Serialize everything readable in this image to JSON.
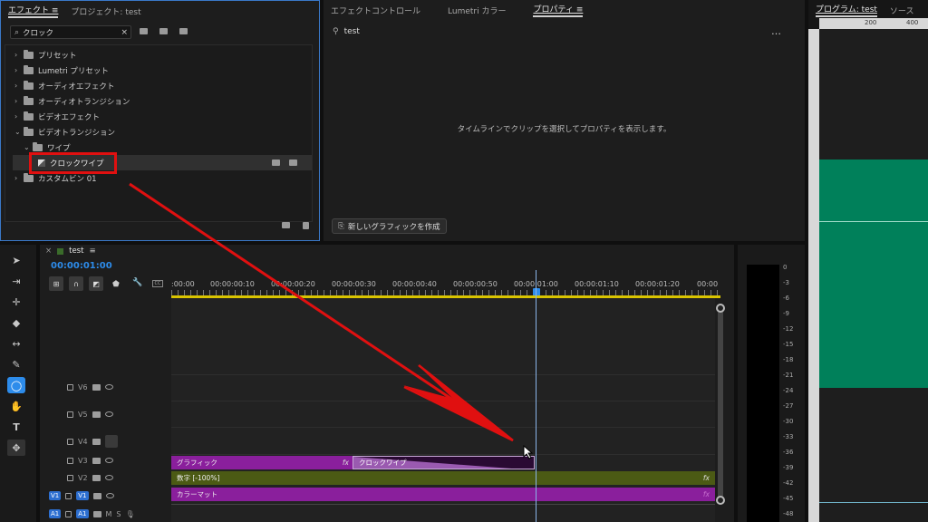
{
  "effects_panel": {
    "tabs": [
      "エフェクト",
      "プロジェクト: test"
    ],
    "menu_icon": "hamburger-icon",
    "search_value": "クロック",
    "tree": [
      {
        "label": "プリセット",
        "expanded": false
      },
      {
        "label": "Lumetri プリセット",
        "expanded": false
      },
      {
        "label": "オーディオエフェクト",
        "expanded": false
      },
      {
        "label": "オーディオトランジション",
        "expanded": false
      },
      {
        "label": "ビデオエフェクト",
        "expanded": false
      },
      {
        "label": "ビデオトランジション",
        "expanded": true
      },
      {
        "label": "ワイプ",
        "expanded": true
      },
      {
        "label": "クロックワイプ",
        "selected": true
      },
      {
        "label": "カスタムビン 01",
        "expanded": false
      }
    ]
  },
  "props_panel": {
    "tabs": [
      "エフェクトコントロール",
      "Lumetri カラー",
      "プロパティ"
    ],
    "active_tab": "プロパティ",
    "item_title": "test",
    "more_icon": "…",
    "message": "タイムラインでクリップを選択してプロパティを表示します。",
    "new_graphic_label": "新しいグラフィックを作成"
  },
  "program_panel": {
    "tabs": [
      "プログラム: test",
      "ソース"
    ],
    "ruler_labels": [
      "200",
      "400"
    ],
    "preview_color": "#00805a"
  },
  "timeline": {
    "sequence_tab": "test",
    "timecode": "00:00:01:00",
    "ruler_labels": [
      ":00:00",
      "00:00:00:10",
      "00:00:00:20",
      "00:00:00:30",
      "00:00:00:40",
      "00:00:00:50",
      "00:00:01:00",
      "00:00:01:10",
      "00:00:01:20",
      "00:00"
    ],
    "playhead_at_seconds": 1.0,
    "tracks": [
      {
        "name": "V6"
      },
      {
        "name": "V5"
      },
      {
        "name": "V4"
      },
      {
        "name": "V3"
      },
      {
        "name": "V2"
      },
      {
        "name": "V1",
        "source": "V1"
      },
      {
        "name": "A1",
        "source": "A1",
        "extra": [
          "M",
          "S"
        ]
      }
    ],
    "clips": {
      "graphic": "グラフィック",
      "transition": "クロックワイプ",
      "text": "数字 [-100%]",
      "matte": "カラーマット",
      "fx": "fx"
    }
  },
  "meter_labels": [
    "0",
    "-3",
    "-6",
    "-9",
    "-12",
    "-15",
    "-18",
    "-21",
    "-24",
    "-27",
    "-30",
    "-33",
    "-36",
    "-39",
    "-42",
    "-45",
    "-48"
  ],
  "tools": [
    "selection-tool-icon",
    "track-select-icon",
    "ripple-edit-icon",
    "razor-icon",
    "slip-icon",
    "pen-icon",
    "ellipse-icon",
    "hand-icon",
    "type-icon",
    "color-picker-icon"
  ],
  "colors": {
    "accent_blue": "#2d8ceb",
    "clip_purple": "#8a1f9c",
    "clip_olive": "#4b5a14",
    "annotation_red": "#e01010",
    "preview_green": "#00805a"
  }
}
